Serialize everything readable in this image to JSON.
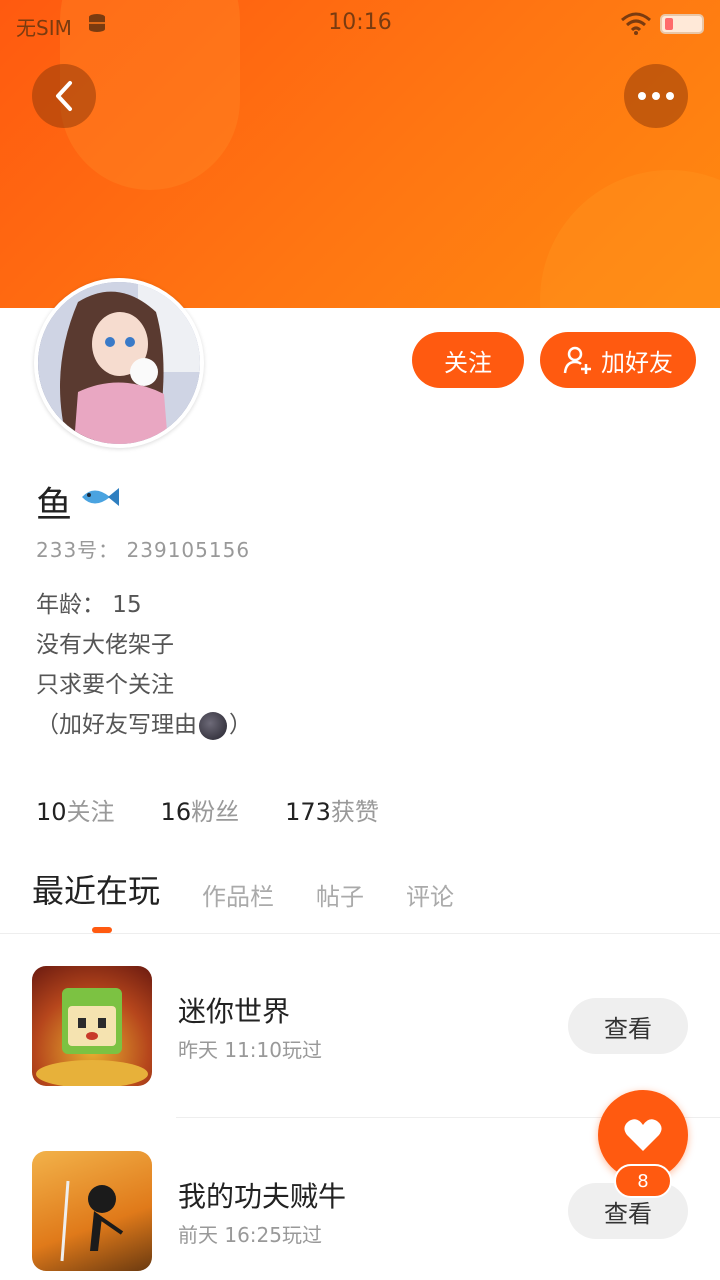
{
  "status_bar": {
    "carrier": "无SIM",
    "time": "10:16"
  },
  "header": {
    "back_icon": "chevron-left-icon",
    "more_icon": "more-dots-icon"
  },
  "profile": {
    "name": "鱼",
    "name_emoji": "fish-icon",
    "uid": "233号：  239105156",
    "follow_label": "关注",
    "add_friend_label": "加好友",
    "bio": [
      "年龄：  15",
      "没有大佬架子",
      "只求要个关注",
      "（加好友写理由",
      "）"
    ]
  },
  "stats": [
    {
      "num": "10",
      "label": "关注"
    },
    {
      "num": "16",
      "label": "粉丝"
    },
    {
      "num": "173",
      "label": "获赞"
    }
  ],
  "tabs": [
    "最近在玩",
    "作品栏",
    "帖子",
    "评论"
  ],
  "games": [
    {
      "name": "迷你世界",
      "time": "昨天 11:10玩过",
      "view_label": "查看"
    },
    {
      "name": "我的功夫贼牛",
      "time": "前天 16:25玩过",
      "view_label": "查看"
    }
  ],
  "fab": {
    "badge": "8"
  },
  "colors": {
    "accent": "#ff5a10"
  }
}
